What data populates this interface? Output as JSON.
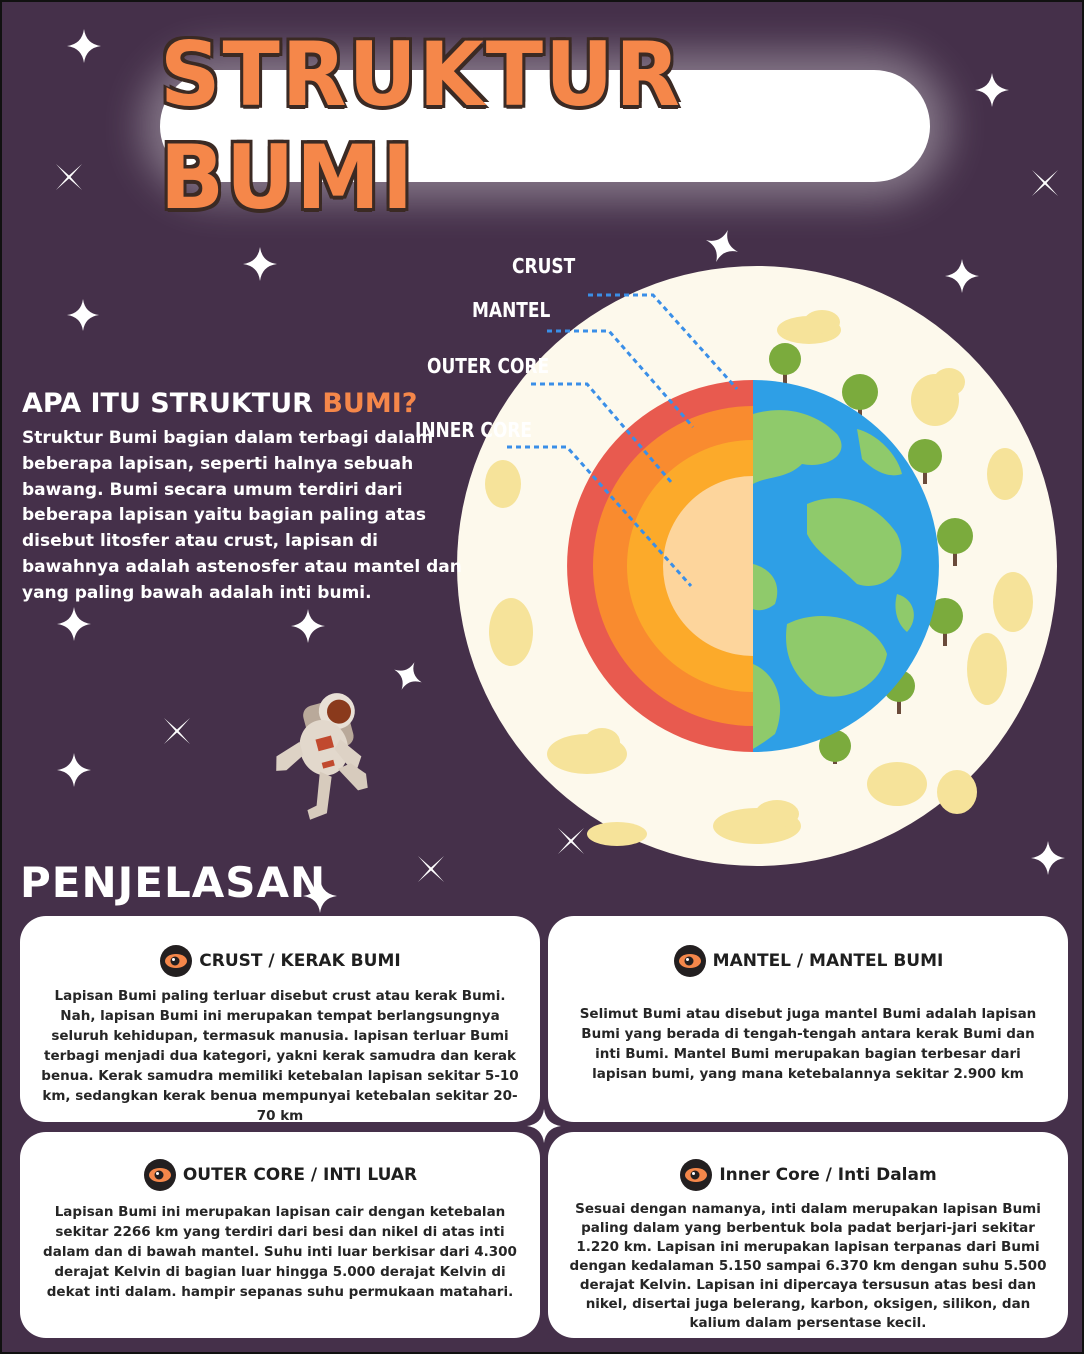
{
  "title": "STRUKTUR BUMI",
  "intro": {
    "heading_main": "APA ITU STRUKTUR ",
    "heading_accent": "BUMI?",
    "text": "Struktur Bumi bagian dalam terbagi dalam beberapa lapisan, seperti halnya sebuah bawang. Bumi secara umum terdiri dari beberapa lapisan yaitu bagian paling atas disebut litosfer atau crust, lapisan di bawahnya adalah astenosfer atau mantel dan yang paling bawah adalah inti bumi."
  },
  "diagram": {
    "labels": {
      "crust": "CRUST",
      "mantel": "MANTEL",
      "outer_core": "OUTER CORE",
      "inner_core": "INNER CORE"
    },
    "colors": {
      "crust": "#e85a4f",
      "mantel": "#f98b2f",
      "outer_core": "#fcaa2a",
      "inner_core": "#fdd59c",
      "ocean": "#2e9fe6",
      "land": "#8fca6b",
      "leader_line": "#3a8fe8",
      "disc": "#fdf9ec",
      "cloud": "#f6e39a"
    }
  },
  "section_title": "PENJELASAN",
  "cards": [
    {
      "title": "CRUST / KERAK BUMI",
      "icon": "eye-icon",
      "body": "Lapisan Bumi paling terluar disebut crust atau kerak Bumi. Nah, lapisan Bumi ini merupakan tempat berlangsungnya seluruh kehidupan, termasuk manusia. lapisan terluar Bumi terbagi menjadi dua kategori, yakni kerak samudra dan kerak benua. Kerak samudra memiliki ketebalan lapisan sekitar 5-10 km, sedangkan kerak benua mempunyai ketebalan sekitar 20-70 km"
    },
    {
      "title": "MANTEL / MANTEL BUMI",
      "icon": "eye-icon",
      "body": "Selimut Bumi atau disebut juga mantel Bumi adalah lapisan Bumi yang berada di tengah-tengah antara kerak Bumi dan inti Bumi. Mantel Bumi merupakan bagian terbesar dari lapisan bumi, yang mana ketebalannya sekitar 2.900 km"
    },
    {
      "title": "OUTER CORE / INTI LUAR",
      "icon": "eye-icon",
      "body": "Lapisan Bumi ini merupakan lapisan cair dengan ketebalan sekitar 2266 km yang terdiri dari besi dan nikel di atas inti dalam dan di bawah mantel. Suhu inti luar berkisar dari 4.300 derajat Kelvin di bagian luar hingga 5.000 derajat Kelvin di dekat inti dalam. hampir sepanas suhu permukaan matahari."
    },
    {
      "title": "Inner Core / Inti Dalam",
      "icon": "eye-icon",
      "body": "Sesuai dengan namanya, inti dalam merupakan lapisan Bumi paling dalam yang berbentuk bola padat berjari-jari sekitar 1.220 km. Lapisan ini merupakan lapisan terpanas dari Bumi dengan kedalaman 5.150 sampai 6.370 km dengan suhu 5.500 derajat Kelvin. Lapisan ini dipercaya tersusun atas besi dan nikel, disertai juga belerang, karbon, oksigen, silikon, dan kalium dalam persentase kecil."
    }
  ]
}
